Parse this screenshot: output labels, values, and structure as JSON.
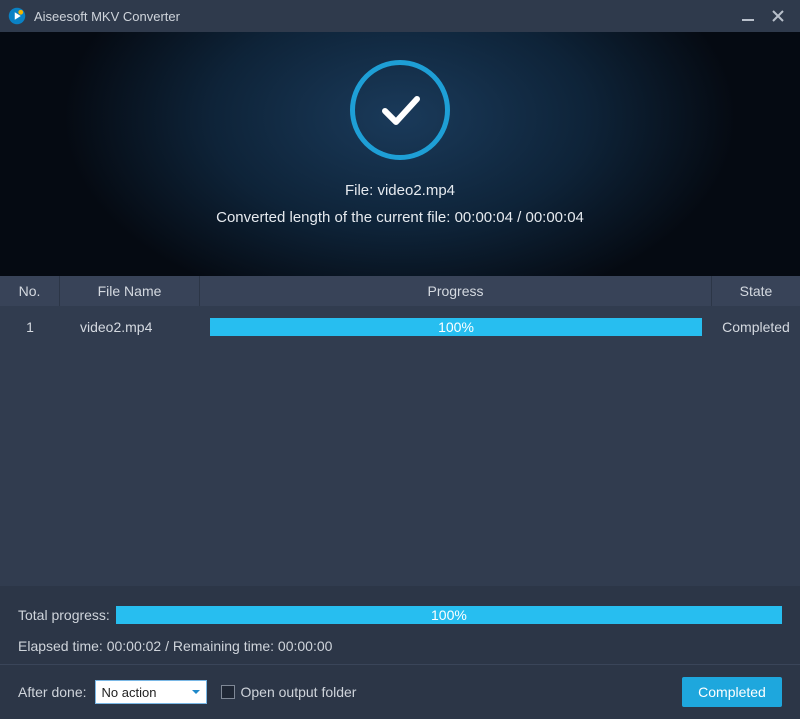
{
  "titlebar": {
    "title": "Aiseesoft MKV Converter"
  },
  "hero": {
    "file_label": "File: video2.mp4",
    "converted_label": "Converted length of the current file: 00:00:04 / 00:00:04"
  },
  "table": {
    "headers": {
      "no": "No.",
      "name": "File Name",
      "progress": "Progress",
      "state": "State"
    },
    "rows": [
      {
        "no": "1",
        "name": "video2.mp4",
        "progress_pct": "100%",
        "state": "Completed"
      }
    ]
  },
  "summary": {
    "total_label": "Total progress:",
    "total_pct": "100%",
    "times_line": "Elapsed time: 00:00:02 / Remaining time: 00:00:00"
  },
  "footer": {
    "after_done_label": "After done:",
    "after_done_value": "No action",
    "open_output_label": "Open output folder",
    "button_label": "Completed"
  },
  "colors": {
    "accent": "#27bef0",
    "ring": "#1e9fd6"
  }
}
